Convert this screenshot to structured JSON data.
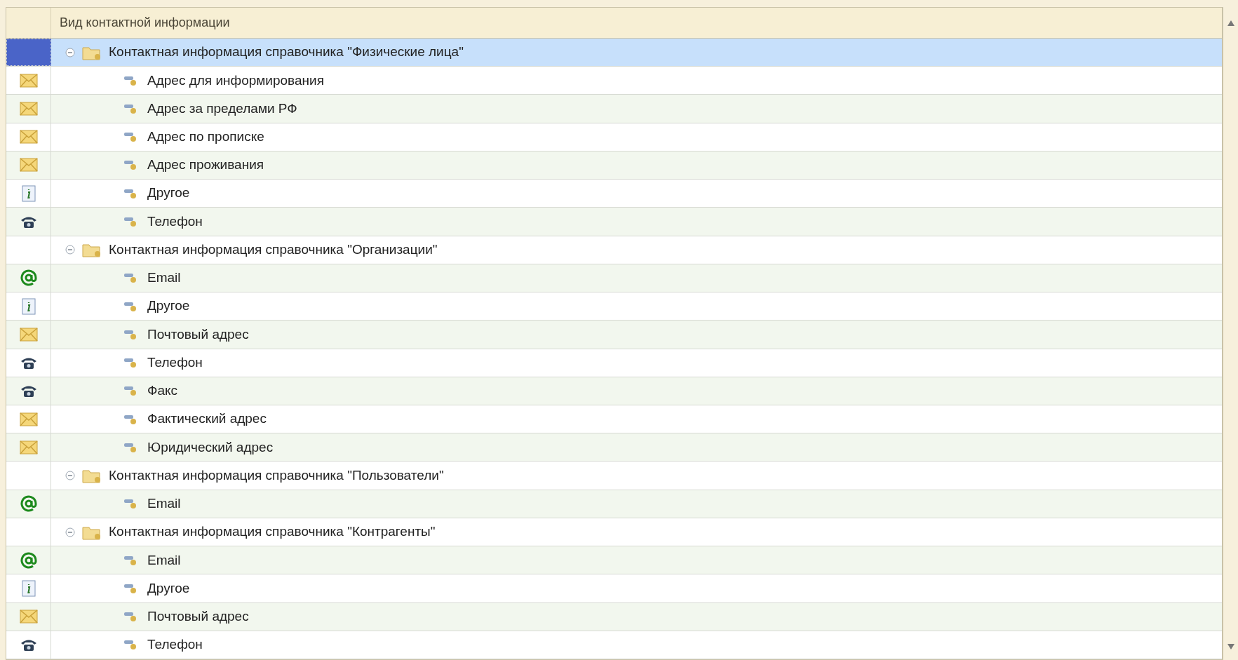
{
  "table": {
    "columns": [
      {
        "label": "Вид контактной информации"
      }
    ],
    "groups": [
      {
        "label": "Контактная информация справочника \"Физические лица\"",
        "expanded": true,
        "selected": true,
        "children": [
          {
            "label": "Адрес для информирования",
            "kind": "address",
            "selected": false
          },
          {
            "label": "Адрес за пределами РФ",
            "kind": "address",
            "selected": false
          },
          {
            "label": "Адрес по прописке",
            "kind": "address",
            "selected": false
          },
          {
            "label": "Адрес проживания",
            "kind": "address",
            "selected": false
          },
          {
            "label": "Другое",
            "kind": "other",
            "selected": false
          },
          {
            "label": "Телефон",
            "kind": "phone",
            "selected": false
          }
        ]
      },
      {
        "label": "Контактная информация справочника \"Организации\"",
        "expanded": true,
        "selected": false,
        "children": [
          {
            "label": "Email",
            "kind": "email",
            "selected": false
          },
          {
            "label": "Другое",
            "kind": "other",
            "selected": false
          },
          {
            "label": "Почтовый адрес",
            "kind": "address",
            "selected": false
          },
          {
            "label": "Телефон",
            "kind": "phone",
            "selected": false
          },
          {
            "label": "Факс",
            "kind": "phone",
            "selected": false
          },
          {
            "label": "Фактический адрес",
            "kind": "address",
            "selected": false
          },
          {
            "label": "Юридический адрес",
            "kind": "address",
            "selected": false
          }
        ]
      },
      {
        "label": "Контактная информация справочника \"Пользователи\"",
        "expanded": true,
        "selected": false,
        "children": [
          {
            "label": "Email",
            "kind": "email",
            "selected": false
          }
        ]
      },
      {
        "label": "Контактная информация справочника \"Контрагенты\"",
        "expanded": true,
        "selected": false,
        "children": [
          {
            "label": "Email",
            "kind": "email",
            "selected": false
          },
          {
            "label": "Другое",
            "kind": "other",
            "selected": false
          },
          {
            "label": "Почтовый адрес",
            "kind": "address",
            "selected": false
          },
          {
            "label": "Телефон",
            "kind": "phone",
            "selected": false
          }
        ]
      }
    ]
  }
}
